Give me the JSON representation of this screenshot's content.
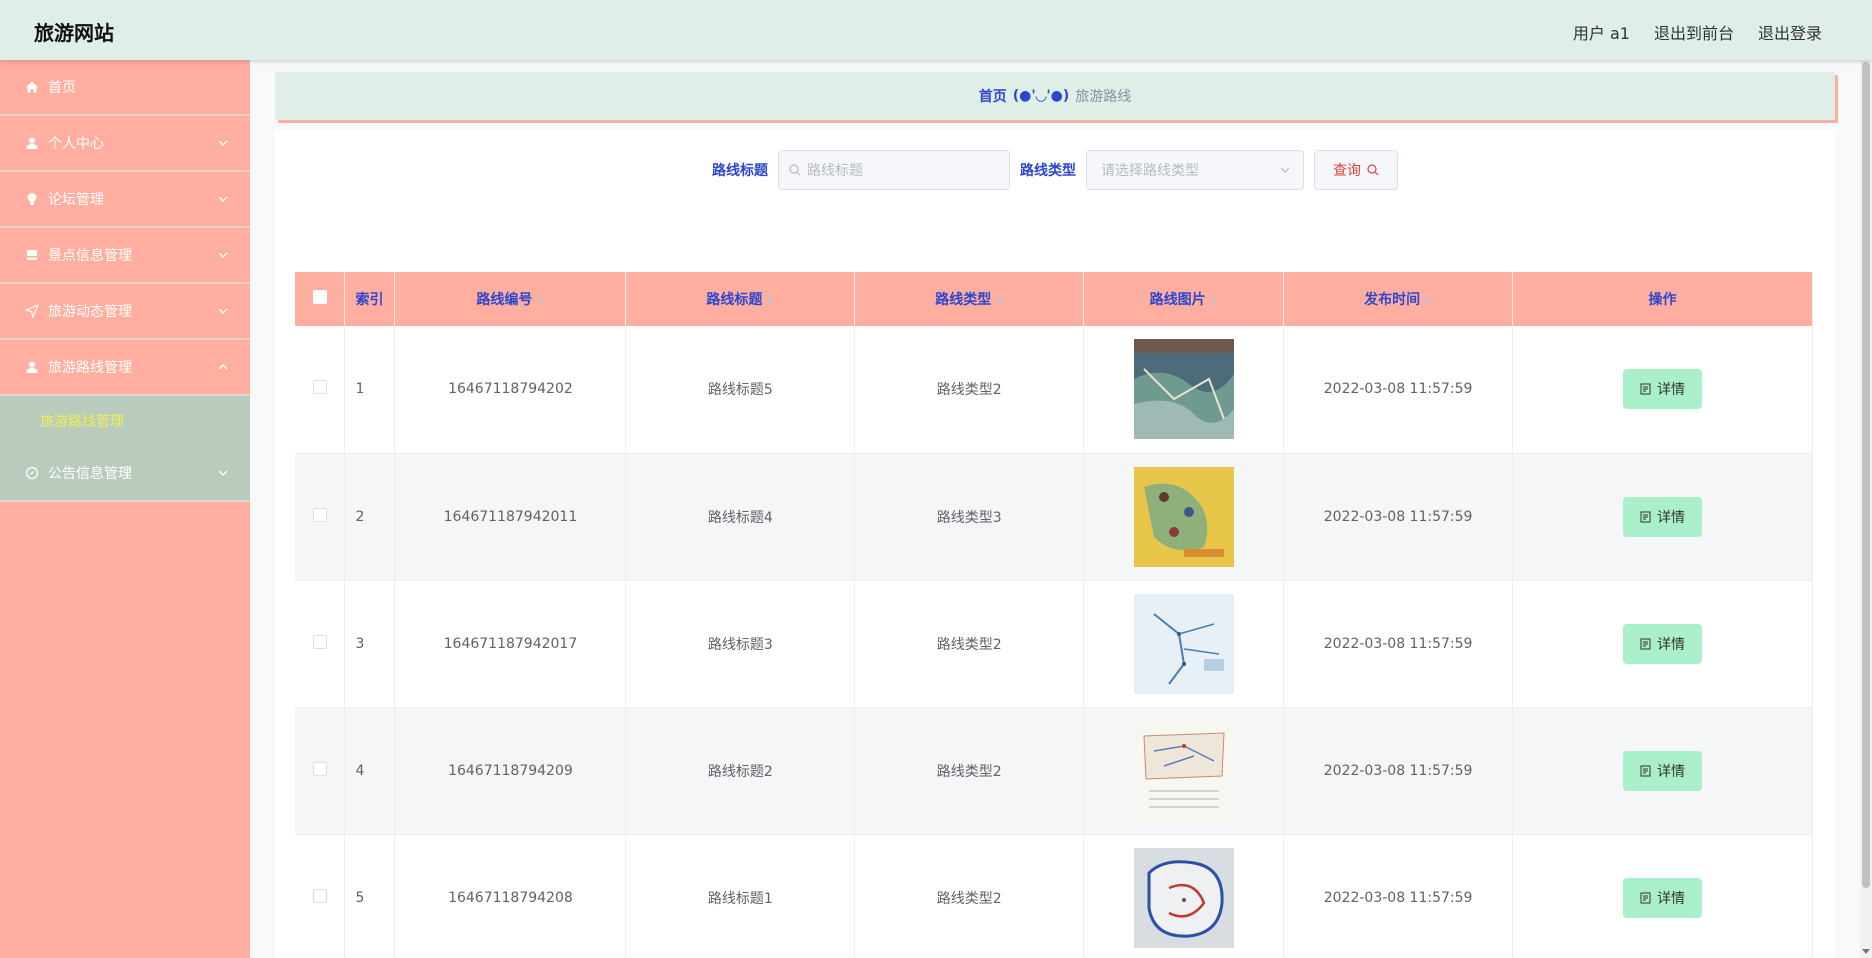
{
  "header": {
    "brand": "旅游网站",
    "user": "用户 a1",
    "to_front": "退出到前台",
    "logout": "退出登录"
  },
  "sidebar": {
    "items": [
      {
        "label": "首页",
        "icon": "home-icon"
      },
      {
        "label": "个人中心",
        "icon": "user-icon"
      },
      {
        "label": "论坛管理",
        "icon": "bulb-icon"
      },
      {
        "label": "景点信息管理",
        "icon": "notebook-icon"
      },
      {
        "label": "旅游动态管理",
        "icon": "send-icon"
      },
      {
        "label": "旅游路线管理",
        "icon": "user-solid-icon"
      },
      {
        "label": "旅游路线管理",
        "icon": "submenu"
      },
      {
        "label": "公告信息管理",
        "icon": "compass-icon"
      }
    ]
  },
  "breadcrumb": {
    "home": "首页",
    "face": "(●'◡'●)",
    "current": "旅游路线"
  },
  "search": {
    "title_label": "路线标题",
    "title_placeholder": "路线标题",
    "type_label": "路线类型",
    "type_placeholder": "请选择路线类型",
    "query_button": "查询"
  },
  "table": {
    "headers": {
      "index": "索引",
      "code": "路线编号",
      "title": "路线标题",
      "type": "路线类型",
      "image": "路线图片",
      "time": "发布时间",
      "action": "操作"
    },
    "detail_label": "详情",
    "rows": [
      {
        "index": "1",
        "code": "16467118794202",
        "title": "路线标题5",
        "type": "路线类型2",
        "time": "2022-03-08 11:57:59"
      },
      {
        "index": "2",
        "code": "164671187942011",
        "title": "路线标题4",
        "type": "路线类型3",
        "time": "2022-03-08 11:57:59"
      },
      {
        "index": "3",
        "code": "164671187942017",
        "title": "路线标题3",
        "type": "路线类型2",
        "time": "2022-03-08 11:57:59"
      },
      {
        "index": "4",
        "code": "16467118794209",
        "title": "路线标题2",
        "type": "路线类型2",
        "time": "2022-03-08 11:57:59"
      },
      {
        "index": "5",
        "code": "16467118794208",
        "title": "路线标题1",
        "type": "路线类型2",
        "time": "2022-03-08 11:57:59"
      }
    ]
  },
  "colors": {
    "accent_salmon": "#ffae9f",
    "header_mint": "#dfeee7",
    "link_blue": "#2d48cf",
    "detail_green": "#a9efc9"
  }
}
